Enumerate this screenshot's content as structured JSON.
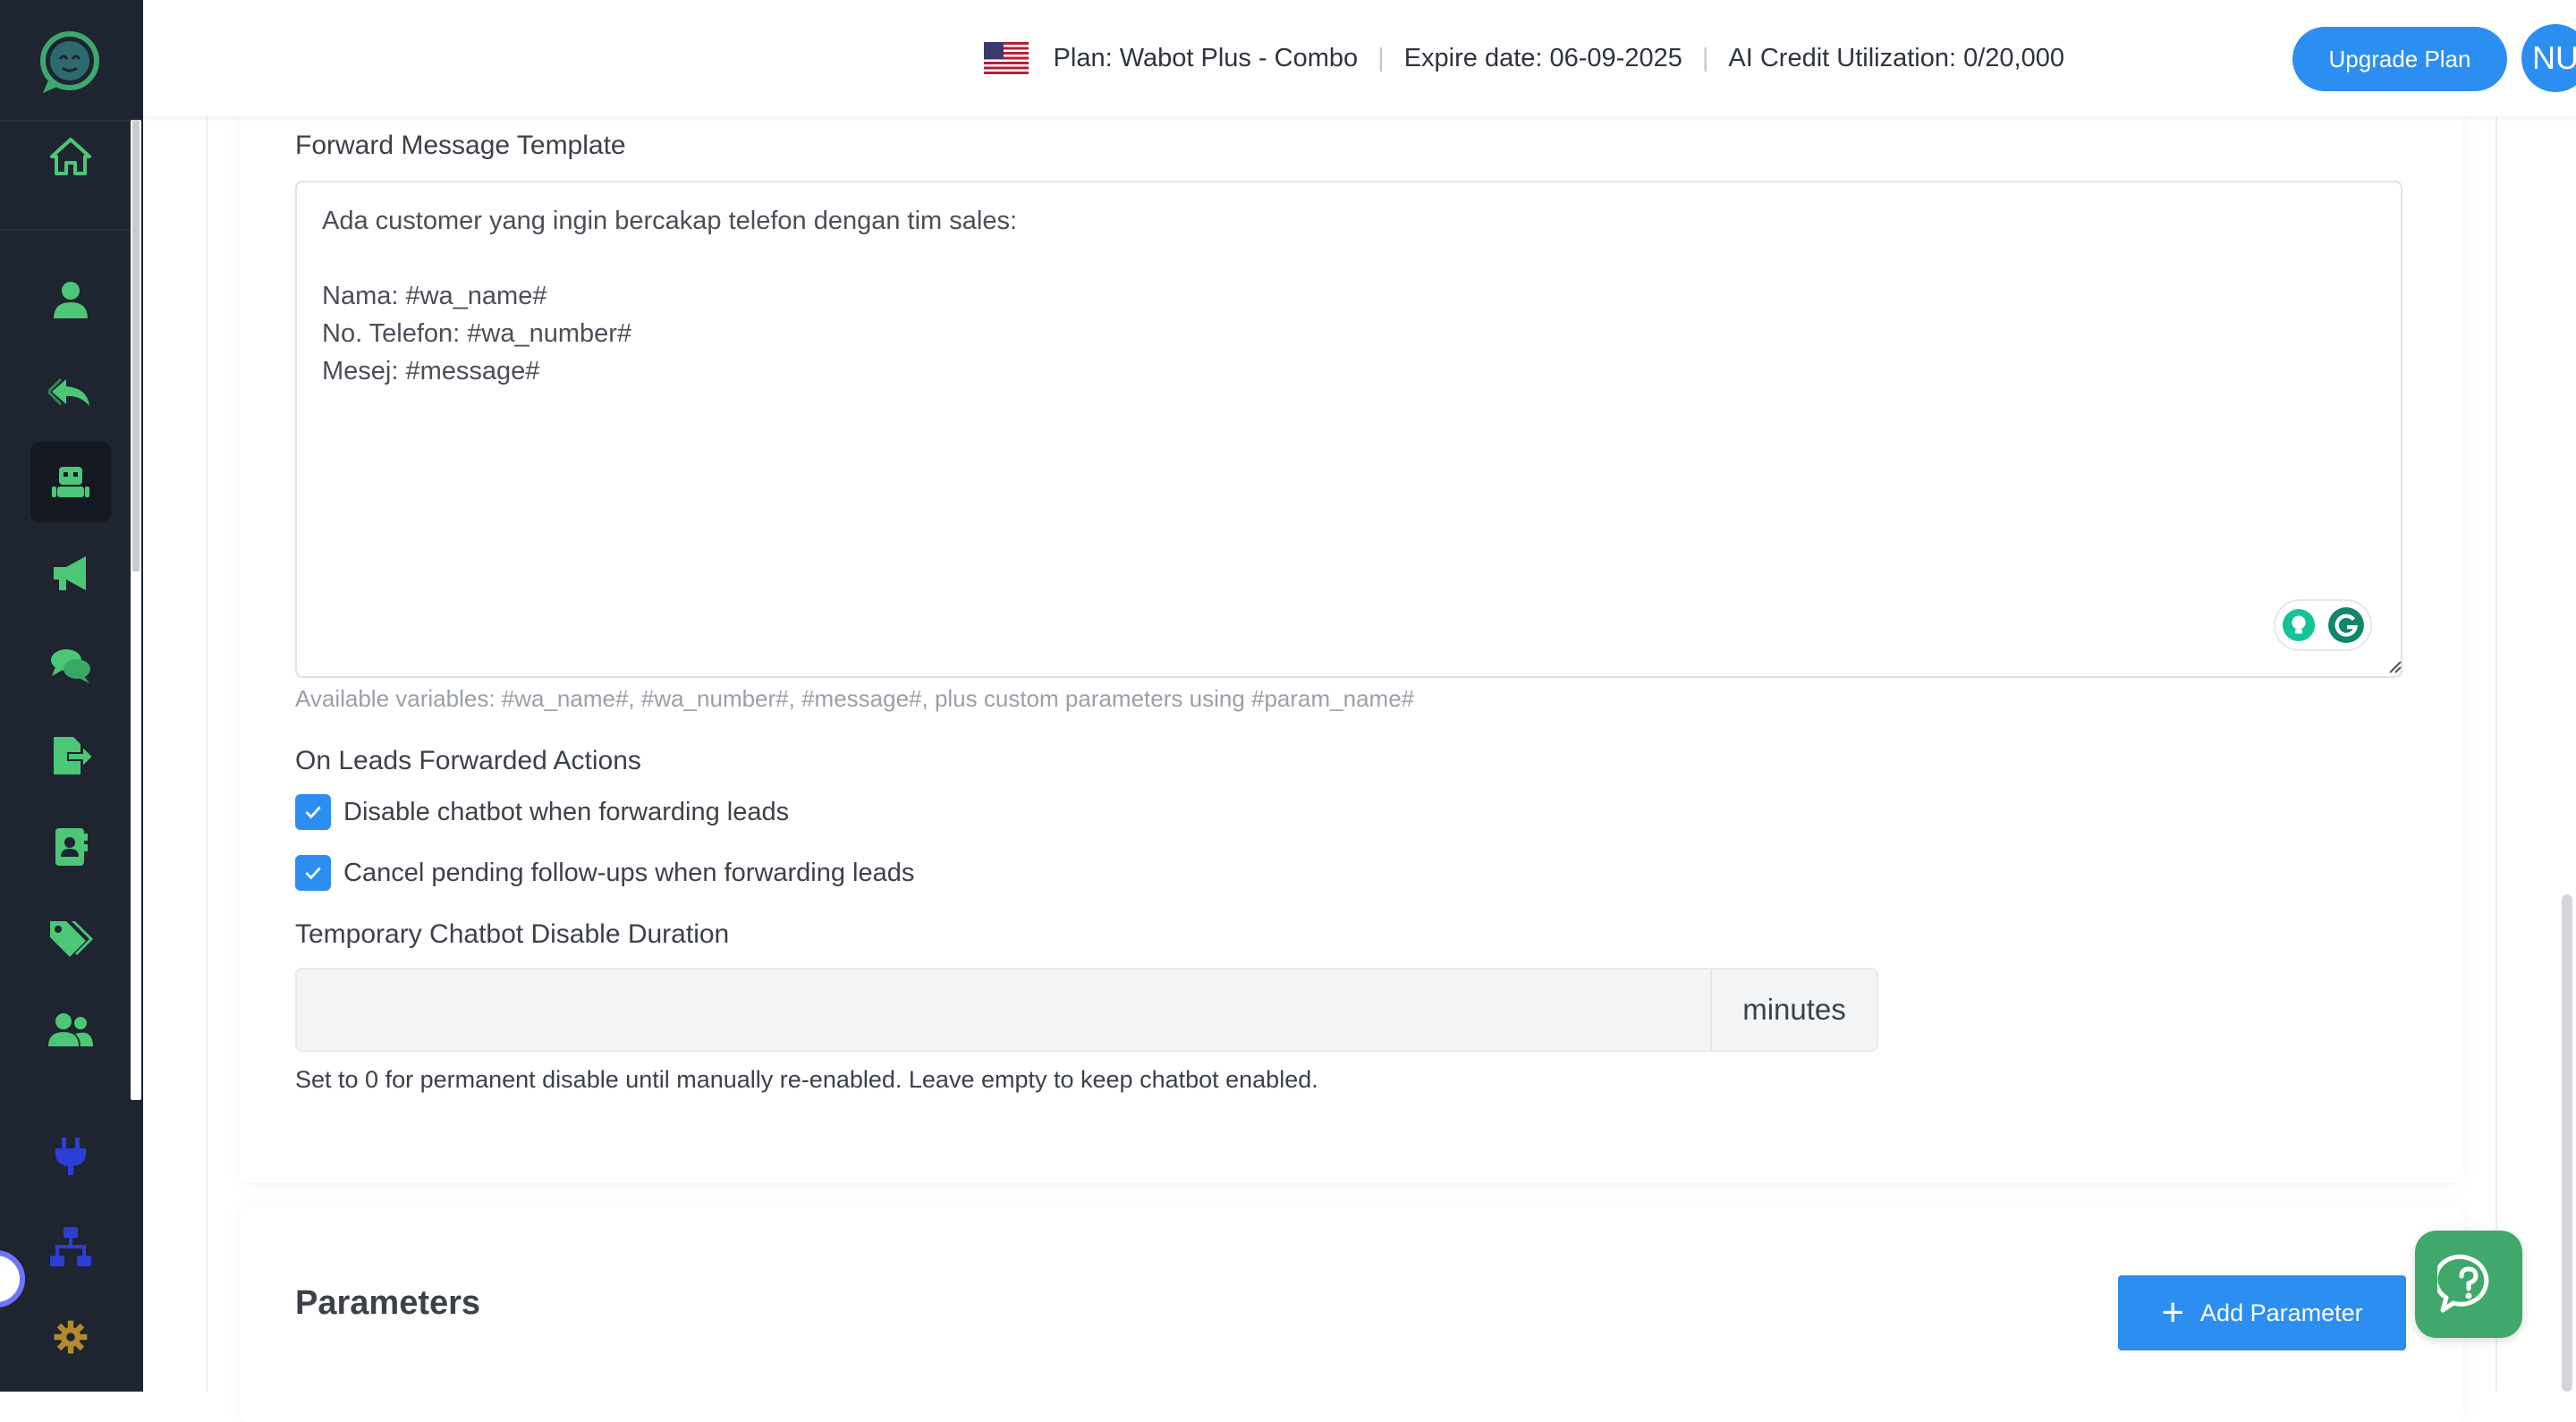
{
  "header": {
    "plan": "Plan: Wabot Plus - Combo",
    "expire": "Expire date: 06-09-2025",
    "ai_credit": "AI Credit Utilization: 0/20,000",
    "upgrade_label": "Upgrade Plan",
    "avatar_initials": "NU",
    "flag_icon": "us-flag-icon"
  },
  "sidebar": {
    "logo_icon": "chat-bot-logo-icon",
    "items": [
      {
        "name": "home",
        "icon": "home-icon",
        "active": false
      },
      {
        "name": "contacts",
        "icon": "user-icon",
        "active": false
      },
      {
        "name": "auto-reply",
        "icon": "reply-icon",
        "active": false
      },
      {
        "name": "chatbot",
        "icon": "robot-icon",
        "active": true
      },
      {
        "name": "broadcast",
        "icon": "megaphone-icon",
        "active": false
      },
      {
        "name": "conversations",
        "icon": "chat-bubbles-icon",
        "active": false
      },
      {
        "name": "export",
        "icon": "file-export-icon",
        "active": false
      },
      {
        "name": "address-book",
        "icon": "address-book-icon",
        "active": false
      },
      {
        "name": "tags",
        "icon": "tags-icon",
        "active": false
      },
      {
        "name": "team",
        "icon": "users-icon",
        "active": false
      },
      {
        "name": "integrations",
        "icon": "plug-icon",
        "active": false
      },
      {
        "name": "flows",
        "icon": "sitemap-icon",
        "active": false
      },
      {
        "name": "settings",
        "icon": "gear-icon",
        "active": false
      }
    ]
  },
  "form": {
    "template_label": "Forward Message Template",
    "template_value": "Ada customer yang ingin bercakap telefon dengan tim sales:\n\nNama: #wa_name#\nNo. Telefon: #wa_number#\nMesej: #message#",
    "variables_hint": "Available variables: #wa_name#, #wa_number#, #message#, plus custom parameters using #param_name#",
    "actions_label": "On Leads Forwarded Actions",
    "checkboxes": [
      {
        "label": "Disable chatbot when forwarding leads",
        "checked": true
      },
      {
        "label": "Cancel pending follow-ups when forwarding leads",
        "checked": true
      }
    ],
    "duration_label": "Temporary Chatbot Disable Duration",
    "duration_value": "",
    "duration_suffix": "minutes",
    "duration_help": "Set to 0 for permanent disable until manually re-enabled. Leave empty to keep chatbot enabled."
  },
  "parameters": {
    "title": "Parameters",
    "add_label": "Add Parameter"
  },
  "colors": {
    "sidebar_bg": "#1e2430",
    "accent_blue": "#2c8ef0",
    "icon_green": "#4cc776",
    "icon_blue": "#2b3fd6",
    "gear_gold": "#b38a2e",
    "fab_green": "#3fa86a"
  }
}
